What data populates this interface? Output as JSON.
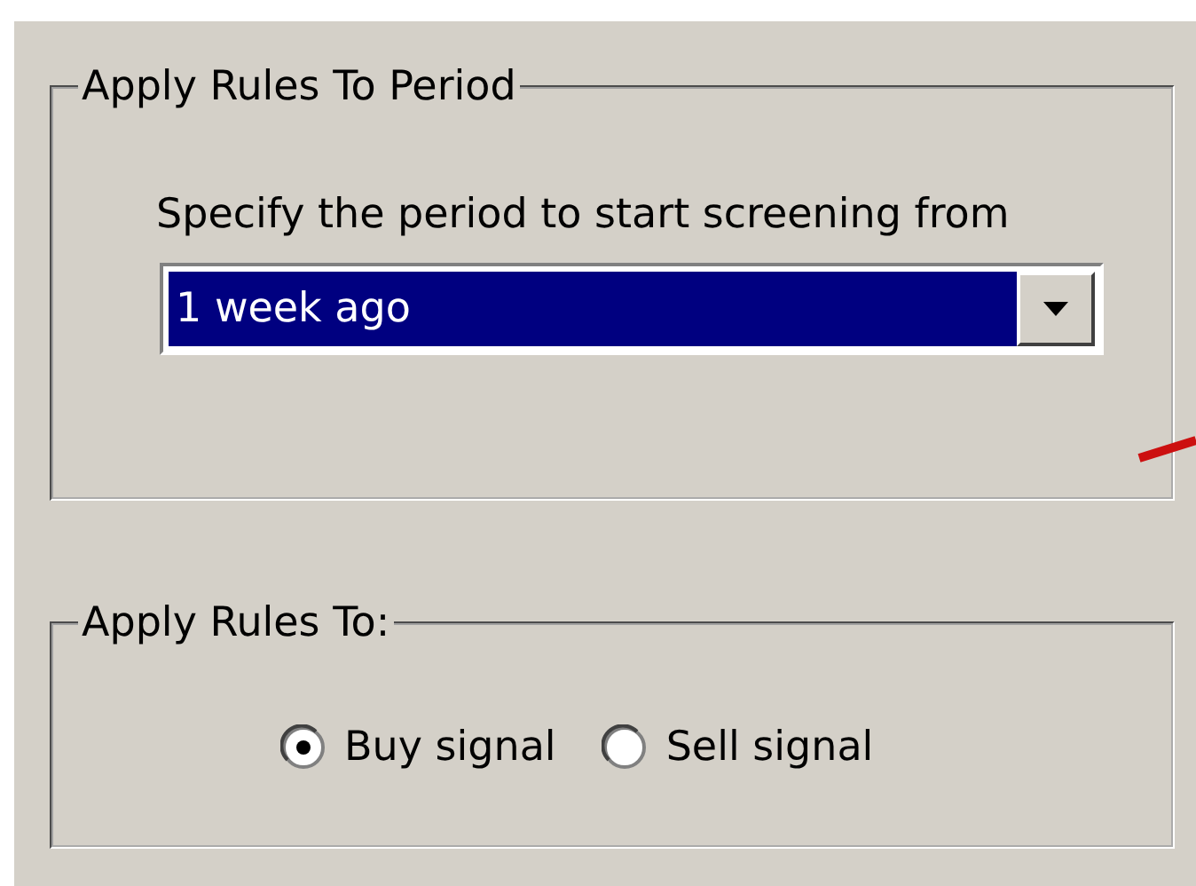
{
  "period_group": {
    "title": "Apply Rules To Period",
    "prompt": "Specify the period to start screening from",
    "dropdown": {
      "value": "1 week ago",
      "selected": true
    }
  },
  "apply_group": {
    "title": "Apply Rules To:",
    "options": [
      {
        "label": "Buy signal",
        "selected": true
      },
      {
        "label": "Sell signal",
        "selected": false
      }
    ]
  }
}
